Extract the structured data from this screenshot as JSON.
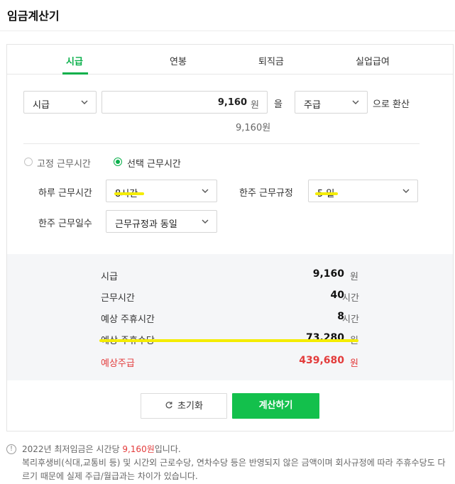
{
  "header": {
    "title": "임금계산기"
  },
  "tabs": [
    {
      "label": "시급",
      "active": true
    },
    {
      "label": "연봉",
      "active": false
    },
    {
      "label": "퇴직금",
      "active": false
    },
    {
      "label": "실업급여",
      "active": false
    }
  ],
  "converter": {
    "from_unit": "시급",
    "amount": "9,160",
    "amount_unit": "원",
    "particle": "을",
    "to_unit": "주급",
    "suffix": "으로 환산",
    "amount_preview": "9,160원"
  },
  "work_mode": {
    "fixed_label": "고정 근무시간",
    "selected_label": "선택 근무시간",
    "selected": "선택 근무시간"
  },
  "fields": {
    "daily_hours_label": "하루 근무시간",
    "daily_hours_value": "8시간",
    "weekly_rule_label": "한주 근무규정",
    "weekly_rule_value": "5 일",
    "weekly_days_label": "한주 근무일수",
    "weekly_days_value": "근무규정과 동일"
  },
  "summary": {
    "rows": [
      {
        "label": "시급",
        "value": "9,160",
        "unit": "원"
      },
      {
        "label": "근무시간",
        "value": "40",
        "unit": "시간"
      },
      {
        "label": "예상 주휴시간",
        "value": "8",
        "unit": "시간"
      },
      {
        "label": "예상 주휴수당",
        "value": "73,280",
        "unit": "원"
      },
      {
        "label": "예상주급",
        "value": "439,680",
        "unit": "원"
      }
    ]
  },
  "buttons": {
    "reset": "초기화",
    "calculate": "계산하기"
  },
  "notice": {
    "line1_prefix": "2022년 최저임금은 시간당 ",
    "line1_highlight": "9,160원",
    "line1_suffix": "입니다.",
    "line2": "복리후생비(식대,교통비 등) 및 시간외 근로수당, 연차수당 등은 반영되지 않은 금액이며 회사규정에 따라 주휴수당도 다르기 때문에 실제 주급/월급과는 차이가 있습니다."
  },
  "colors": {
    "accent": "#0bb04b",
    "button": "#13c04c",
    "warning": "#e33b3b",
    "highlight": "#f4ec00"
  }
}
